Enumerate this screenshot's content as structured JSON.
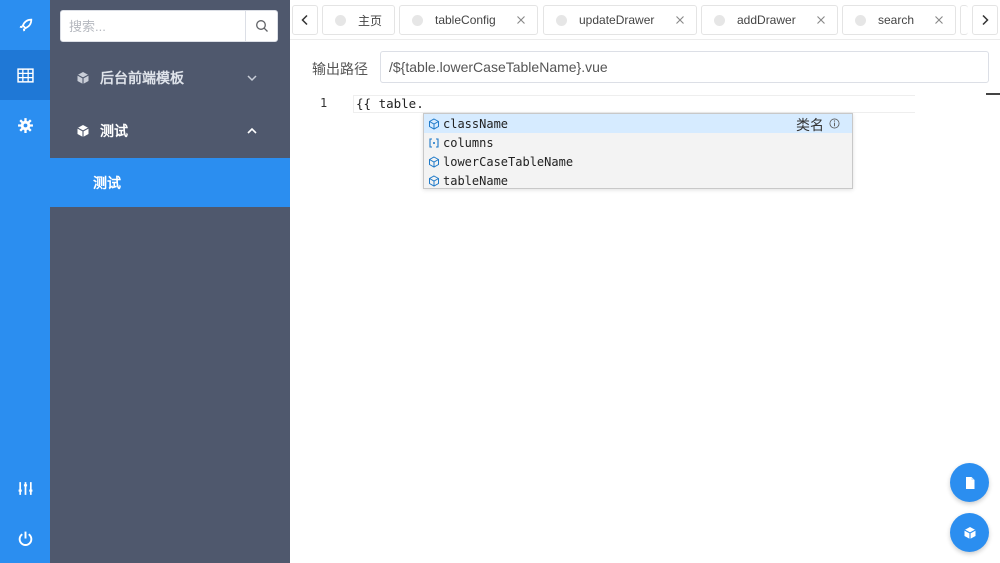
{
  "rail": {
    "icons": [
      "rocket-icon",
      "grid-icon",
      "gear-icon",
      "sliders-icon",
      "power-icon"
    ]
  },
  "sidebar": {
    "search_placeholder": "搜索...",
    "menu": [
      {
        "label": "后台前端模板",
        "expanded": false
      },
      {
        "label": "测试",
        "expanded": true
      }
    ],
    "submenu": [
      {
        "label": "测试",
        "active": true
      }
    ]
  },
  "tabs": [
    {
      "label": "主页",
      "closable": false
    },
    {
      "label": "tableConfig",
      "closable": true
    },
    {
      "label": "updateDrawer",
      "closable": true
    },
    {
      "label": "addDrawer",
      "closable": true
    },
    {
      "label": "search",
      "closable": true
    }
  ],
  "path": {
    "label": "输出路径",
    "value": "/${table.lowerCaseTableName}.vue"
  },
  "editor": {
    "line_number": "1",
    "code": "{{ table.",
    "suggestions": [
      {
        "label": "className",
        "kind": "property",
        "detail": "类名",
        "selected": true
      },
      {
        "label": "columns",
        "kind": "array",
        "detail": "",
        "selected": false
      },
      {
        "label": "lowerCaseTableName",
        "kind": "property",
        "detail": "",
        "selected": false
      },
      {
        "label": "tableName",
        "kind": "property",
        "detail": "",
        "selected": false
      }
    ]
  },
  "colors": {
    "accent": "#2b8ef0",
    "sidebar_bg": "#4f586d",
    "suggest_selected": "#d6ebff"
  }
}
